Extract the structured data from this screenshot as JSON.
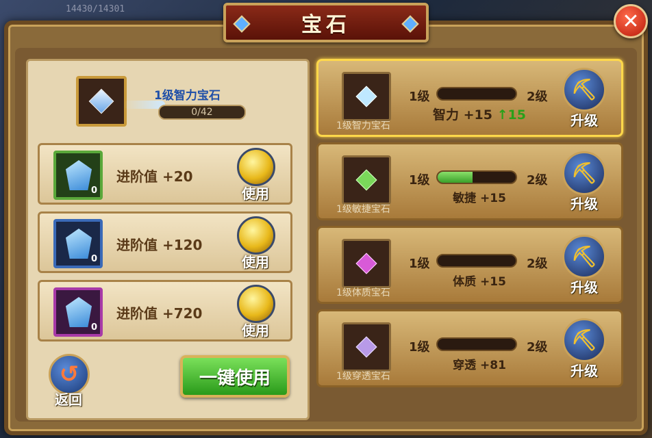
{
  "window": {
    "title": "宝石"
  },
  "background": {
    "text_top": "14430/14301",
    "text_left": "433"
  },
  "header": {
    "close_label": "✕"
  },
  "current_gem": {
    "name": "1级智力宝石",
    "progress_text": "0/42",
    "progress": 0
  },
  "materials": [
    {
      "label": "进阶值 +20",
      "count": "0",
      "color": "green",
      "use_label": "使用"
    },
    {
      "label": "进阶值 +120",
      "count": "0",
      "color": "blue",
      "use_label": "使用"
    },
    {
      "label": "进阶值 +720",
      "count": "0",
      "color": "purple",
      "use_label": "使用"
    }
  ],
  "actions": {
    "back_label": "返回",
    "one_key_label": "一键使用"
  },
  "gems": [
    {
      "name": "1级智力宝石",
      "from": "1级",
      "to": "2级",
      "progress": 0,
      "stat": "智力 +15",
      "stat_up": "15",
      "color": "#bfe8ff",
      "upgrade_label": "升级",
      "selected": true
    },
    {
      "name": "1级敏捷宝石",
      "from": "1级",
      "to": "2级",
      "progress": 0.45,
      "stat": "敏捷 +15",
      "stat_up": "",
      "color": "#7ad85a",
      "upgrade_label": "升级",
      "selected": false
    },
    {
      "name": "1级体质宝石",
      "from": "1级",
      "to": "2级",
      "progress": 0,
      "stat": "体质 +15",
      "stat_up": "",
      "color": "#d85ad8",
      "upgrade_label": "升级",
      "selected": false
    },
    {
      "name": "1级穿透宝石",
      "from": "1级",
      "to": "2级",
      "progress": 0,
      "stat": "穿透 +81",
      "stat_up": "",
      "color": "#b89ae8",
      "upgrade_label": "升级",
      "selected": false
    }
  ]
}
